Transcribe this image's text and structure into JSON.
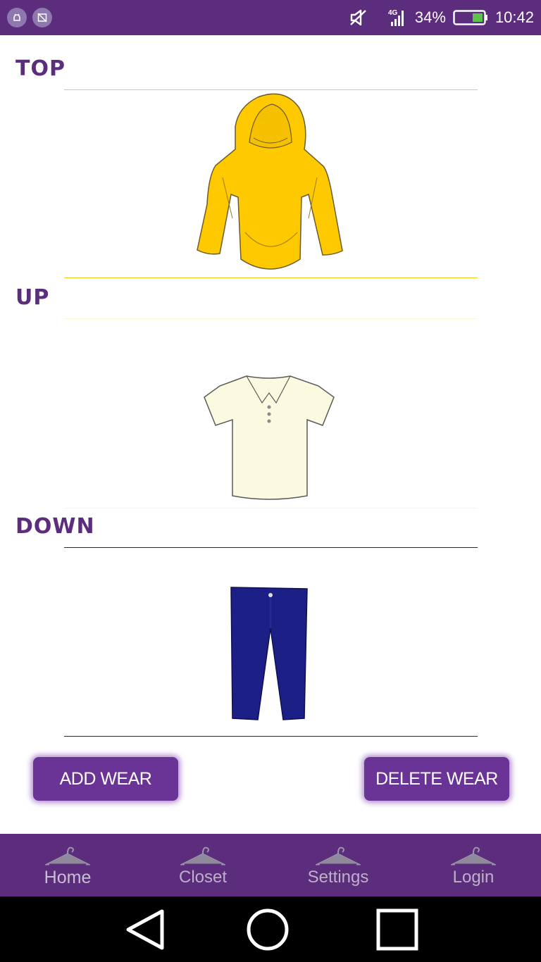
{
  "status_bar": {
    "battery": "34%",
    "time": "10:42",
    "network": "4G",
    "icons": [
      "android-debug-icon",
      "screenshot-icon",
      "mute-icon",
      "signal-icon",
      "battery-icon"
    ]
  },
  "sections": [
    {
      "label": "TOP",
      "garment": "yellow-hoodie",
      "garment_color": "#ffc900",
      "divider_color": "#f2d020"
    },
    {
      "label": "UP",
      "garment": "cream-polo-shirt",
      "garment_color": "#fbfae0",
      "divider_color": "#fbf7d5"
    },
    {
      "label": "DOWN",
      "garment": "navy-pants",
      "garment_color": "#1c1f86",
      "divider_color": "#2a2a2a"
    }
  ],
  "actions": {
    "add_label": "ADD WEAR",
    "delete_label": "DELETE WEAR"
  },
  "bottom_nav": {
    "items": [
      {
        "label": "Home",
        "icon": "hanger-icon",
        "active": true
      },
      {
        "label": "Closet",
        "icon": "hanger-icon"
      },
      {
        "label": "Settings",
        "icon": "hanger-icon"
      },
      {
        "label": "Login",
        "icon": "hanger-icon"
      }
    ]
  },
  "system_nav": [
    "back-icon",
    "home-circle-icon",
    "recents-icon"
  ],
  "colors": {
    "primary": "#5c2d7c",
    "button": "#6a3396",
    "nav_label": "#bcb1c9"
  }
}
